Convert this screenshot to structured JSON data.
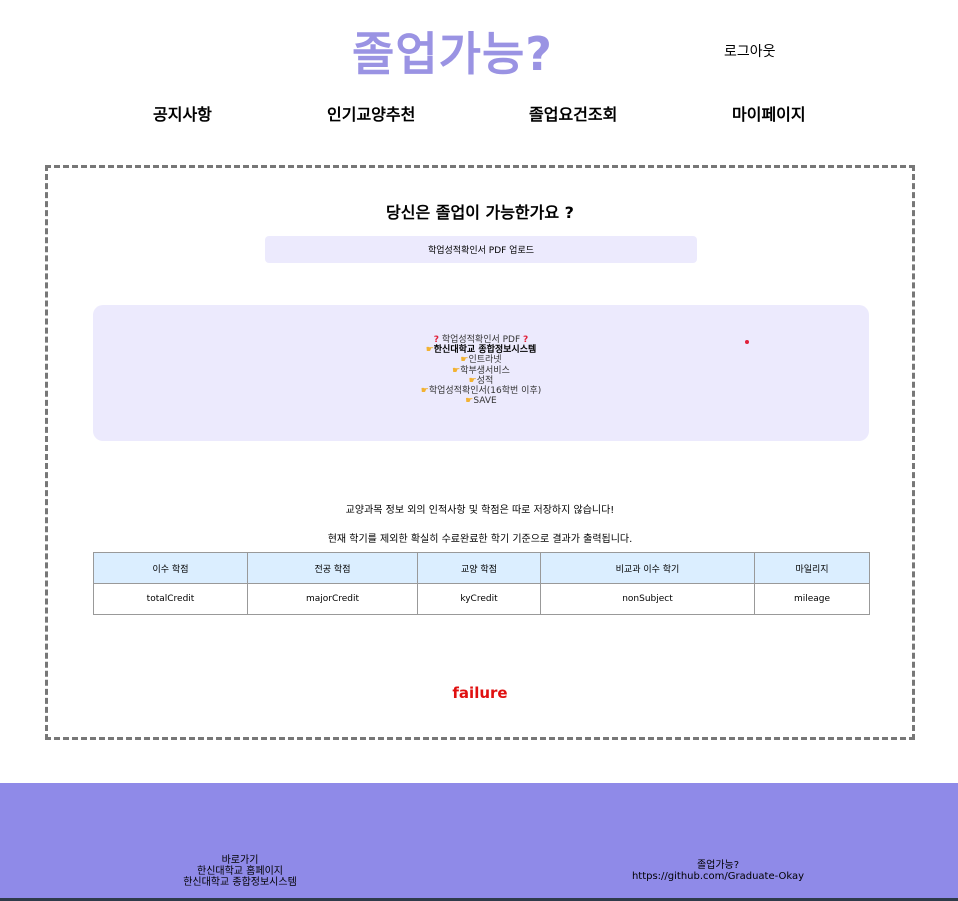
{
  "header": {
    "logo": "졸업가능?",
    "logout": "로그아웃"
  },
  "nav": [
    "공지사항",
    "인기교양추천",
    "졸업요건조회",
    "마이페이지"
  ],
  "main": {
    "question": "당신은 졸업이 가능한가요 ?",
    "upload_label": "학업성적확인서 PDF 업로드",
    "guide": {
      "title": "학업성적확인서 PDF",
      "steps": [
        "한신대학교 종합정보시스템",
        "인트라넷",
        "학부생서비스",
        "성적",
        "학업성적확인서(16학번 이후)",
        "SAVE"
      ]
    },
    "notice1": "교양과목 정보 외의 인적사항 및 학점은 따로 저장하지 않습니다!",
    "notice2": "현재 학기를 제외한 확실히 수료완료한 학기 기준으로 결과가 출력됩니다.",
    "table": {
      "headers": [
        "이수 학점",
        "전공 학점",
        "교양 학점",
        "비교과 이수 학기",
        "마일리지"
      ],
      "values": [
        "totalCredit",
        "majorCredit",
        "kyCredit",
        "nonSubject",
        "mileage"
      ]
    },
    "result": "failure"
  },
  "footer": {
    "left": [
      "바로가기",
      "한신대학교 홈페이지",
      "한신대학교 종합정보시스템"
    ],
    "right": [
      "졸업가능?",
      "https://github.com/Graduate-Okay"
    ]
  },
  "colors": {
    "brand": "#9a93e3",
    "footer_bg": "#8f8ae8",
    "panel_bg": "#eceafd",
    "table_header_bg": "#dbeeff",
    "failure": "#e01010"
  }
}
